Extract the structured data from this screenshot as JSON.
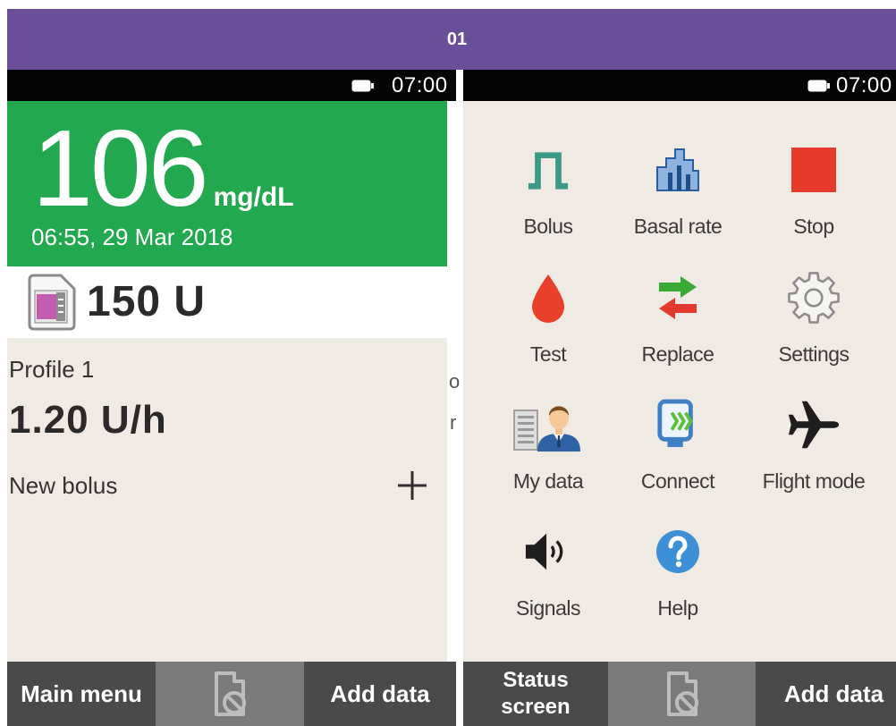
{
  "header": {
    "title": "01"
  },
  "left_screen": {
    "status_bar": {
      "time": "07:00",
      "icon": "battery-icon"
    },
    "glucose": {
      "value": "106",
      "unit": "mg/dL",
      "timestamp": "06:55, 29 Mar 2018"
    },
    "cartridge": {
      "icon": "cartridge-icon",
      "amount": "150 U"
    },
    "basal": {
      "profile": "Profile 1",
      "rate": "1.20 U/h"
    },
    "new_bolus": {
      "label": "New bolus",
      "icon": "plus-icon"
    },
    "nav": {
      "left_label": "Main menu",
      "center_icon": "pump-disabled-icon",
      "right_label": "Add data"
    }
  },
  "gap_text": [
    "o",
    "r"
  ],
  "right_screen": {
    "status_bar": {
      "time": "07:00",
      "icon": "battery-icon"
    },
    "menu": [
      {
        "label": "Bolus",
        "icon": "bolus-icon"
      },
      {
        "label": "Basal rate",
        "icon": "basal-rate-icon"
      },
      {
        "label": "Stop",
        "icon": "stop-icon"
      },
      {
        "label": "Test",
        "icon": "blood-drop-icon"
      },
      {
        "label": "Replace",
        "icon": "replace-arrows-icon"
      },
      {
        "label": "Settings",
        "icon": "gear-icon"
      },
      {
        "label": "My data",
        "icon": "my-data-icon"
      },
      {
        "label": "Connect",
        "icon": "connect-icon"
      },
      {
        "label": "Flight mode",
        "icon": "airplane-icon"
      },
      {
        "label": "Signals",
        "icon": "speaker-icon"
      },
      {
        "label": "Help",
        "icon": "help-icon"
      }
    ],
    "nav": {
      "left_label": "Status screen",
      "center_icon": "pump-disabled-icon",
      "right_label": "Add data"
    }
  },
  "colors": {
    "header": "#6b4e98",
    "glucose_band": "#22a84f",
    "background": "#efebe4",
    "nav": "#4a4a4a",
    "nav_center": "#7a7a7a",
    "stop": "#e63a2c",
    "drop": "#e8402a",
    "help": "#3d8fd6"
  }
}
